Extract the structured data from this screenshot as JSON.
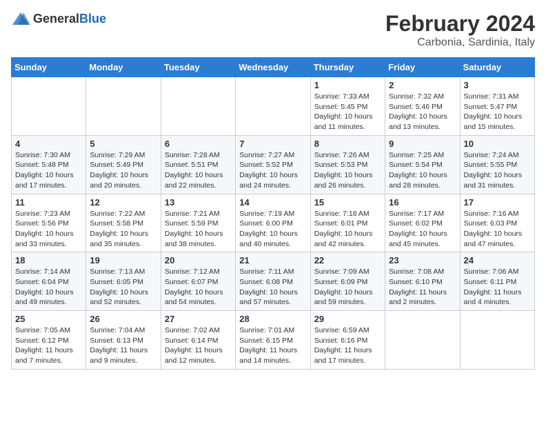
{
  "logo": {
    "general": "General",
    "blue": "Blue"
  },
  "title": "February 2024",
  "subtitle": "Carbonia, Sardinia, Italy",
  "weekdays": [
    "Sunday",
    "Monday",
    "Tuesday",
    "Wednesday",
    "Thursday",
    "Friday",
    "Saturday"
  ],
  "weeks": [
    [
      {
        "day": "",
        "detail": ""
      },
      {
        "day": "",
        "detail": ""
      },
      {
        "day": "",
        "detail": ""
      },
      {
        "day": "",
        "detail": ""
      },
      {
        "day": "1",
        "detail": "Sunrise: 7:33 AM\nSunset: 5:45 PM\nDaylight: 10 hours and 11 minutes."
      },
      {
        "day": "2",
        "detail": "Sunrise: 7:32 AM\nSunset: 5:46 PM\nDaylight: 10 hours and 13 minutes."
      },
      {
        "day": "3",
        "detail": "Sunrise: 7:31 AM\nSunset: 5:47 PM\nDaylight: 10 hours and 15 minutes."
      }
    ],
    [
      {
        "day": "4",
        "detail": "Sunrise: 7:30 AM\nSunset: 5:48 PM\nDaylight: 10 hours and 17 minutes."
      },
      {
        "day": "5",
        "detail": "Sunrise: 7:29 AM\nSunset: 5:49 PM\nDaylight: 10 hours and 20 minutes."
      },
      {
        "day": "6",
        "detail": "Sunrise: 7:28 AM\nSunset: 5:51 PM\nDaylight: 10 hours and 22 minutes."
      },
      {
        "day": "7",
        "detail": "Sunrise: 7:27 AM\nSunset: 5:52 PM\nDaylight: 10 hours and 24 minutes."
      },
      {
        "day": "8",
        "detail": "Sunrise: 7:26 AM\nSunset: 5:53 PM\nDaylight: 10 hours and 26 minutes."
      },
      {
        "day": "9",
        "detail": "Sunrise: 7:25 AM\nSunset: 5:54 PM\nDaylight: 10 hours and 28 minutes."
      },
      {
        "day": "10",
        "detail": "Sunrise: 7:24 AM\nSunset: 5:55 PM\nDaylight: 10 hours and 31 minutes."
      }
    ],
    [
      {
        "day": "11",
        "detail": "Sunrise: 7:23 AM\nSunset: 5:56 PM\nDaylight: 10 hours and 33 minutes."
      },
      {
        "day": "12",
        "detail": "Sunrise: 7:22 AM\nSunset: 5:58 PM\nDaylight: 10 hours and 35 minutes."
      },
      {
        "day": "13",
        "detail": "Sunrise: 7:21 AM\nSunset: 5:59 PM\nDaylight: 10 hours and 38 minutes."
      },
      {
        "day": "14",
        "detail": "Sunrise: 7:19 AM\nSunset: 6:00 PM\nDaylight: 10 hours and 40 minutes."
      },
      {
        "day": "15",
        "detail": "Sunrise: 7:18 AM\nSunset: 6:01 PM\nDaylight: 10 hours and 42 minutes."
      },
      {
        "day": "16",
        "detail": "Sunrise: 7:17 AM\nSunset: 6:02 PM\nDaylight: 10 hours and 45 minutes."
      },
      {
        "day": "17",
        "detail": "Sunrise: 7:16 AM\nSunset: 6:03 PM\nDaylight: 10 hours and 47 minutes."
      }
    ],
    [
      {
        "day": "18",
        "detail": "Sunrise: 7:14 AM\nSunset: 6:04 PM\nDaylight: 10 hours and 49 minutes."
      },
      {
        "day": "19",
        "detail": "Sunrise: 7:13 AM\nSunset: 6:05 PM\nDaylight: 10 hours and 52 minutes."
      },
      {
        "day": "20",
        "detail": "Sunrise: 7:12 AM\nSunset: 6:07 PM\nDaylight: 10 hours and 54 minutes."
      },
      {
        "day": "21",
        "detail": "Sunrise: 7:11 AM\nSunset: 6:08 PM\nDaylight: 10 hours and 57 minutes."
      },
      {
        "day": "22",
        "detail": "Sunrise: 7:09 AM\nSunset: 6:09 PM\nDaylight: 10 hours and 59 minutes."
      },
      {
        "day": "23",
        "detail": "Sunrise: 7:08 AM\nSunset: 6:10 PM\nDaylight: 11 hours and 2 minutes."
      },
      {
        "day": "24",
        "detail": "Sunrise: 7:06 AM\nSunset: 6:11 PM\nDaylight: 11 hours and 4 minutes."
      }
    ],
    [
      {
        "day": "25",
        "detail": "Sunrise: 7:05 AM\nSunset: 6:12 PM\nDaylight: 11 hours and 7 minutes."
      },
      {
        "day": "26",
        "detail": "Sunrise: 7:04 AM\nSunset: 6:13 PM\nDaylight: 11 hours and 9 minutes."
      },
      {
        "day": "27",
        "detail": "Sunrise: 7:02 AM\nSunset: 6:14 PM\nDaylight: 11 hours and 12 minutes."
      },
      {
        "day": "28",
        "detail": "Sunrise: 7:01 AM\nSunset: 6:15 PM\nDaylight: 11 hours and 14 minutes."
      },
      {
        "day": "29",
        "detail": "Sunrise: 6:59 AM\nSunset: 6:16 PM\nDaylight: 11 hours and 17 minutes."
      },
      {
        "day": "",
        "detail": ""
      },
      {
        "day": "",
        "detail": ""
      }
    ]
  ]
}
